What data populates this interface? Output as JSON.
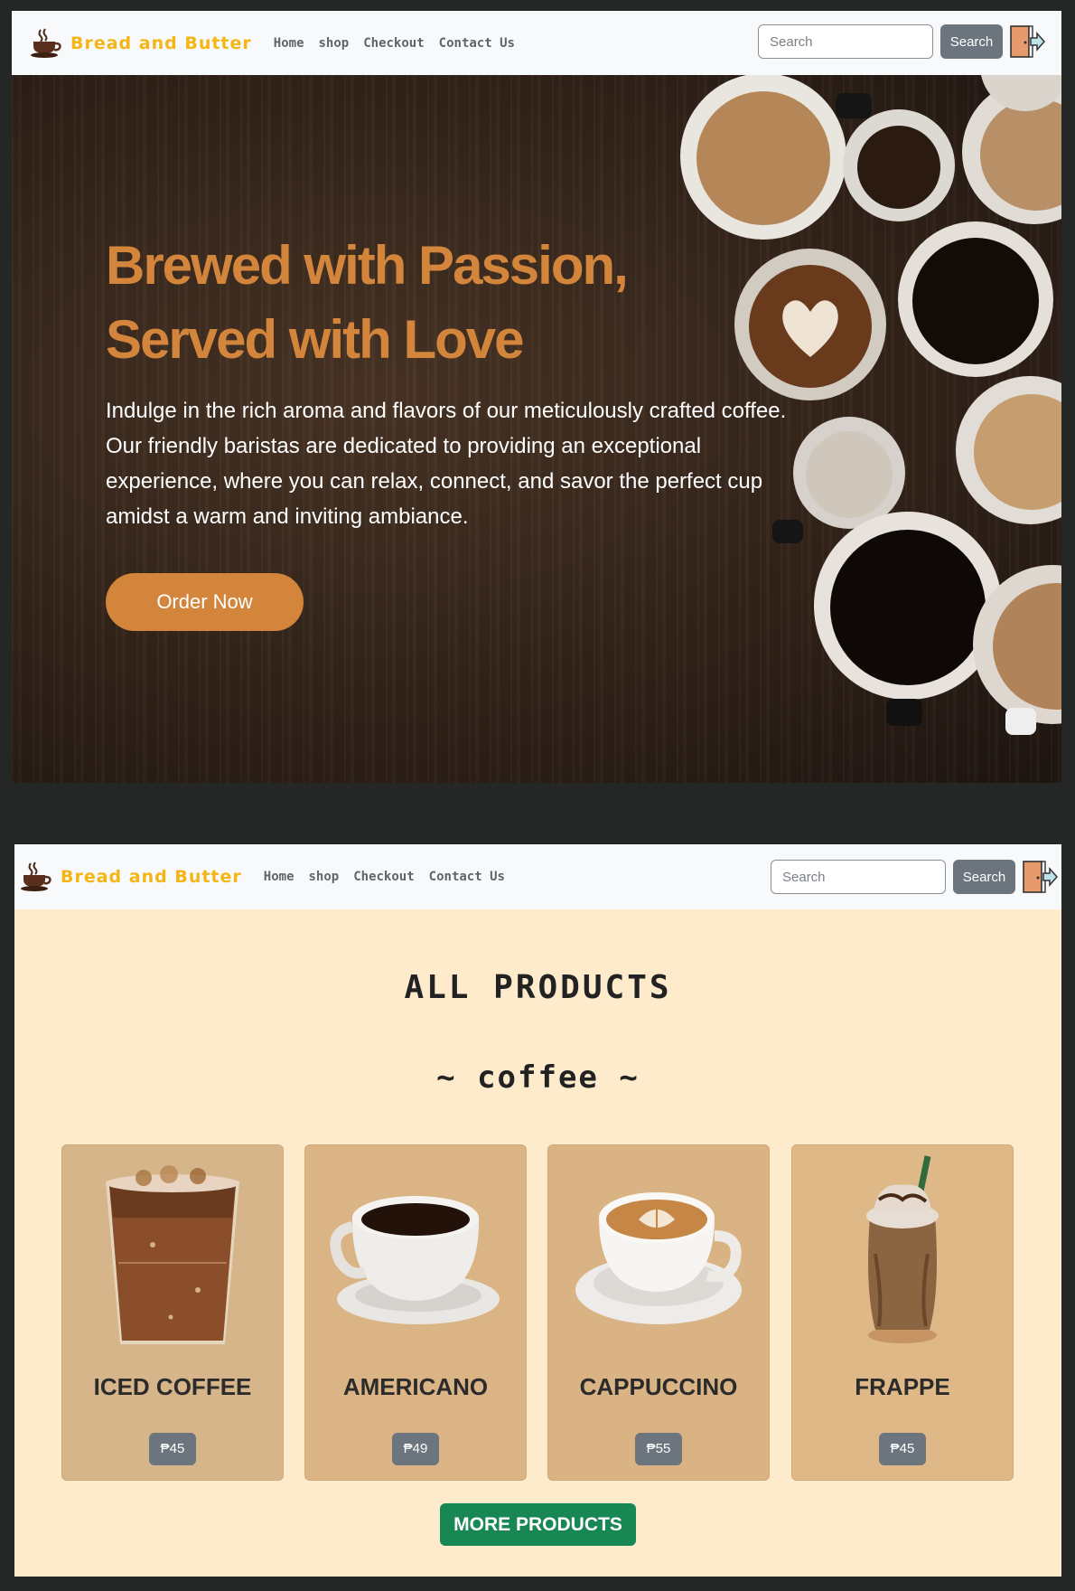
{
  "brand": {
    "name": "Bread and Butter",
    "color": "#f3b614",
    "logo_icon": "coffee-cup-icon"
  },
  "nav": {
    "links": [
      "Home",
      "shop",
      "Checkout",
      "Contact Us"
    ]
  },
  "search": {
    "placeholder": "Search",
    "button_label": "Search"
  },
  "logout_icon": "door-exit-icon",
  "hero": {
    "title": "Brewed with Passion, Served with Love",
    "text": "Indulge in the rich aroma and flavors of our meticulously crafted coffee. Our friendly baristas are dedicated to providing an exceptional experience, where you can relax, connect, and savor the perfect cup amidst a warm and inviting ambiance.",
    "cta_label": "Order Now",
    "accent_color": "#d2853b"
  },
  "products": {
    "title": "ALL PRODUCTS",
    "category_title": "~ coffee ~",
    "items": [
      {
        "name": "ICED COFFEE",
        "price": "₱45",
        "card_color": "#d7b58a"
      },
      {
        "name": "AMERICANO",
        "price": "₱49",
        "card_color": "#dbb486"
      },
      {
        "name": "CAPPUCCINO",
        "price": "₱55",
        "card_color": "#d9b384"
      },
      {
        "name": "FRAPPE",
        "price": "₱45",
        "card_color": "#dfb887"
      }
    ],
    "more_label": "MORE PRODUCTS",
    "more_color": "#198754"
  }
}
